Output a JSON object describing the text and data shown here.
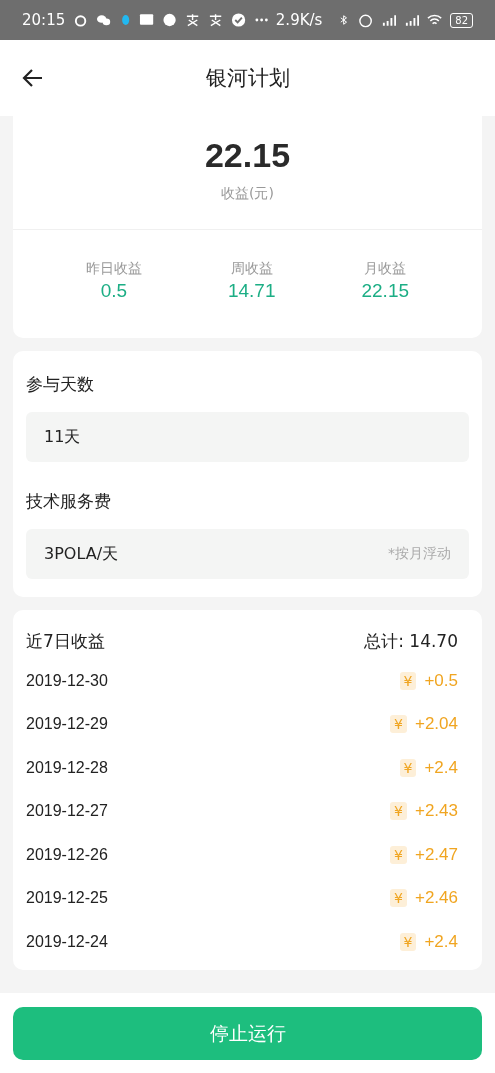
{
  "status_bar": {
    "time": "20:15",
    "speed": "2.9K/s",
    "battery": "82"
  },
  "header": {
    "title": "银河计划"
  },
  "summary": {
    "total": "22.15",
    "total_label": "收益(元)",
    "stats": [
      {
        "label": "昨日收益",
        "value": "0.5"
      },
      {
        "label": "周收益",
        "value": "14.71"
      },
      {
        "label": "月收益",
        "value": "22.15"
      }
    ]
  },
  "info": [
    {
      "label": "参与天数",
      "value": "11天"
    },
    {
      "label": "技术服务费",
      "value": "3POLA/天",
      "note": "*按月浮动"
    }
  ],
  "recent": {
    "title": "近7日收益",
    "total": "总计: 14.70",
    "currency": "¥",
    "rows": [
      {
        "date": "2019-12-30",
        "amount": "+0.5"
      },
      {
        "date": "2019-12-29",
        "amount": "+2.04"
      },
      {
        "date": "2019-12-28",
        "amount": "+2.4"
      },
      {
        "date": "2019-12-27",
        "amount": "+2.43"
      },
      {
        "date": "2019-12-26",
        "amount": "+2.47"
      },
      {
        "date": "2019-12-25",
        "amount": "+2.46"
      },
      {
        "date": "2019-12-24",
        "amount": "+2.4"
      }
    ]
  },
  "action": {
    "label": "停止运行"
  }
}
